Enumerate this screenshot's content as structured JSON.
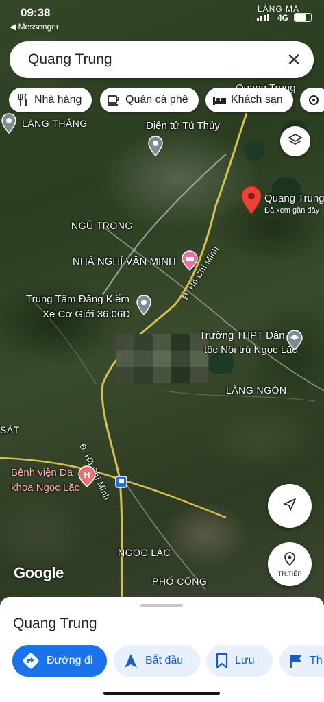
{
  "status_bar": {
    "time": "09:38",
    "back_label": "◀ Messenger",
    "network": "4G",
    "carrier_overlay": "LÀNG MA"
  },
  "search": {
    "query": "Quang Trung",
    "close_icon": "close-icon"
  },
  "chips": [
    {
      "label": "Nhà hàng",
      "icon": "restaurant-icon"
    },
    {
      "label": "Quán cà phê",
      "icon": "coffee-icon"
    },
    {
      "label": "Khách sạn",
      "icon": "hotel-icon"
    },
    {
      "label": "",
      "icon": "more-icon"
    }
  ],
  "map": {
    "labels": {
      "lang_thang": "LÀNG THẮNG",
      "dien_tu": "Điện tử Tú Thủy",
      "ngu_trong": "NGŨ TRONG",
      "nha_nghi": "NHÀ NGHỈ VĂN MINH",
      "trung_tam_1": "Trung Tâm Đăng Kiểm",
      "trung_tam_2": "Xe Cơ Giới 36.06D",
      "road_1": "Đ. Hồ Chí Minh",
      "road_2": "Đ. Hồ Chí Minh",
      "truong_1": "Trường THPT Dân",
      "truong_2": "tộc Nội trú Ngọc Lặc",
      "lang_ngon": "LÀNG NGÒN",
      "sat": "SÁT",
      "benh_vien_1": "Bệnh viện Đa",
      "benh_vien_2": "khoa Ngọc Lặc",
      "ngoc_lac": "NGỌC LẶC",
      "pho_cong": "PHỐ CỐNG",
      "quang_trung": "Quang Trung",
      "quang_trung_sub": "Đã xem gần đây",
      "quang_trung_top": "Quang Trung"
    },
    "attribution": "Google",
    "next_label": "TR.TIẾP"
  },
  "sheet": {
    "title": "Quang Trung",
    "actions": [
      {
        "label": "Đường đi",
        "icon": "directions-icon",
        "primary": true
      },
      {
        "label": "Bắt đầu",
        "icon": "navigation-icon",
        "primary": false
      },
      {
        "label": "Lưu",
        "icon": "bookmark-icon",
        "primary": false
      },
      {
        "label": "Th",
        "icon": "flag-icon",
        "primary": false
      }
    ]
  },
  "colors": {
    "accent": "#1a73e8",
    "pin": "#ea4335",
    "chip_bg": "#ffffff",
    "secondary_btn": "#e8f0fe"
  }
}
